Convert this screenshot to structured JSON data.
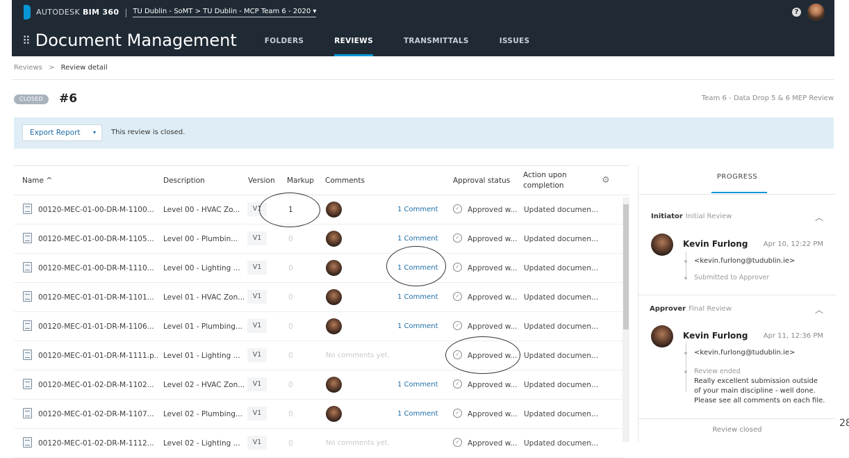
{
  "topbar": {
    "brand_prefix": "AUTODESK",
    "brand_product": "BIM 360",
    "project": "TU Dublin - SoMT > TU Dublin - MCP Team 6 - 2020 ▾"
  },
  "nav": {
    "app_title": "Document Management",
    "tabs": [
      {
        "label": "FOLDERS"
      },
      {
        "label": "REVIEWS"
      },
      {
        "label": "TRANSMITTALS"
      },
      {
        "label": "ISSUES"
      }
    ]
  },
  "breadcrumb": {
    "root": "Reviews",
    "sep": ">",
    "current": "Review detail"
  },
  "review": {
    "status": "CLOSED",
    "number": "#6",
    "name": "Team 6 - Data Drop 5 & 6 MEP Review"
  },
  "banner": {
    "export_label": "Export Report",
    "export_caret": "▾",
    "message": "This review is closed."
  },
  "table": {
    "headers": {
      "name": "Name ^",
      "description": "Description",
      "version": "Version",
      "markup": "Markup",
      "comments": "Comments",
      "approval": "Approval status",
      "action_line1": "Action upon",
      "action_line2": "completion"
    },
    "rows": [
      {
        "name": "00120-MEC-01-00-DR-M-1100...",
        "description": "Level 00 - HVAC Zo...",
        "version": "V1",
        "markup": "1",
        "has_avatar": true,
        "comments": "1 Comment",
        "approval": "Approved w...",
        "action": "Updated documen..."
      },
      {
        "name": "00120-MEC-01-00-DR-M-1105...",
        "description": "Level 00 - Plumbin...",
        "version": "V1",
        "markup": "0",
        "has_avatar": true,
        "comments": "1 Comment",
        "approval": "Approved w...",
        "action": "Updated documen..."
      },
      {
        "name": "00120-MEC-01-00-DR-M-1110...",
        "description": "Level 00 - Lighting ...",
        "version": "V1",
        "markup": "0",
        "has_avatar": true,
        "comments": "1 Comment",
        "approval": "Approved w...",
        "action": "Updated documen..."
      },
      {
        "name": "00120-MEC-01-01-DR-M-1101...",
        "description": "Level 01 - HVAC Zon...",
        "version": "V1",
        "markup": "0",
        "has_avatar": true,
        "comments": "1 Comment",
        "approval": "Approved w...",
        "action": "Updated documen..."
      },
      {
        "name": "00120-MEC-01-01-DR-M-1106...",
        "description": "Level 01 - Plumbing...",
        "version": "V1",
        "markup": "0",
        "has_avatar": true,
        "comments": "1 Comment",
        "approval": "Approved w...",
        "action": "Updated documen..."
      },
      {
        "name": "00120-MEC-01-01-DR-M-1111.p...",
        "description": "Level 01 - Lighting ...",
        "version": "V1",
        "markup": "0",
        "has_avatar": false,
        "comments": "No comments yet.",
        "approval": "Approved w...",
        "action": "Updated documen..."
      },
      {
        "name": "00120-MEC-01-02-DR-M-1102...",
        "description": "Level 02 - HVAC Zon...",
        "version": "V1",
        "markup": "0",
        "has_avatar": true,
        "comments": "1 Comment",
        "approval": "Approved w...",
        "action": "Updated documen..."
      },
      {
        "name": "00120-MEC-01-02-DR-M-1107...",
        "description": "Level 02 - Plumbing...",
        "version": "V1",
        "markup": "0",
        "has_avatar": true,
        "comments": "1 Comment",
        "approval": "Approved w...",
        "action": "Updated documen..."
      },
      {
        "name": "00120-MEC-01-02-DR-M-1112...",
        "description": "Level 02 - Lighting ...",
        "version": "V1",
        "markup": "0",
        "has_avatar": false,
        "comments": "No comments yet.",
        "approval": "Approved w...",
        "action": "Updated documen..."
      }
    ]
  },
  "progress": {
    "tab_label": "PROGRESS",
    "initiator": {
      "role": "Initiator",
      "step": "Initial Review",
      "name": "Kevin Furlong",
      "date": "Apr 10, 12:22 PM",
      "email": "<kevin.furlong@tudublin.ie>",
      "note": "Submitted to Approver"
    },
    "approver": {
      "role": "Approver",
      "step": "Final Review",
      "name": "Kevin Furlong",
      "date": "Apr 11, 12:36 PM",
      "email": "<kevin.furlong@tudublin.ie>",
      "note": "Review ended",
      "comment": "Really excellent submission outside of your main discipline - well done. Please see all comments on each file."
    },
    "footer": "Review closed"
  },
  "page_number": "28",
  "icons": {
    "help": "help-icon",
    "gear": "gear-icon",
    "chevron": "chevron-up-icon",
    "approval": "approval-icon",
    "file": "file-icon"
  },
  "colors": {
    "topbar": "#1f2a35",
    "accent": "#0696d7",
    "link": "#1e6ea7",
    "banner": "#dfeef6"
  }
}
